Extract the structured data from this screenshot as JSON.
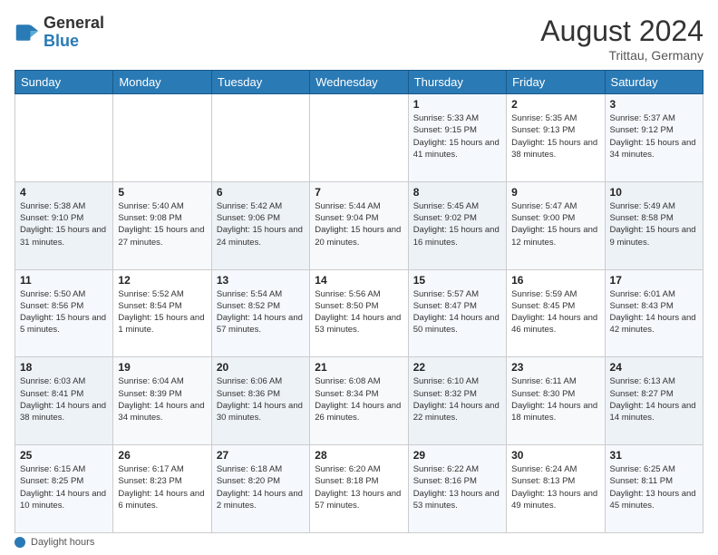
{
  "header": {
    "logo_line1": "General",
    "logo_line2": "Blue",
    "month_year": "August 2024",
    "location": "Trittau, Germany"
  },
  "weekdays": [
    "Sunday",
    "Monday",
    "Tuesday",
    "Wednesday",
    "Thursday",
    "Friday",
    "Saturday"
  ],
  "weeks": [
    [
      {
        "day": "",
        "info": ""
      },
      {
        "day": "",
        "info": ""
      },
      {
        "day": "",
        "info": ""
      },
      {
        "day": "",
        "info": ""
      },
      {
        "day": "1",
        "info": "Sunrise: 5:33 AM\nSunset: 9:15 PM\nDaylight: 15 hours\nand 41 minutes."
      },
      {
        "day": "2",
        "info": "Sunrise: 5:35 AM\nSunset: 9:13 PM\nDaylight: 15 hours\nand 38 minutes."
      },
      {
        "day": "3",
        "info": "Sunrise: 5:37 AM\nSunset: 9:12 PM\nDaylight: 15 hours\nand 34 minutes."
      }
    ],
    [
      {
        "day": "4",
        "info": "Sunrise: 5:38 AM\nSunset: 9:10 PM\nDaylight: 15 hours\nand 31 minutes."
      },
      {
        "day": "5",
        "info": "Sunrise: 5:40 AM\nSunset: 9:08 PM\nDaylight: 15 hours\nand 27 minutes."
      },
      {
        "day": "6",
        "info": "Sunrise: 5:42 AM\nSunset: 9:06 PM\nDaylight: 15 hours\nand 24 minutes."
      },
      {
        "day": "7",
        "info": "Sunrise: 5:44 AM\nSunset: 9:04 PM\nDaylight: 15 hours\nand 20 minutes."
      },
      {
        "day": "8",
        "info": "Sunrise: 5:45 AM\nSunset: 9:02 PM\nDaylight: 15 hours\nand 16 minutes."
      },
      {
        "day": "9",
        "info": "Sunrise: 5:47 AM\nSunset: 9:00 PM\nDaylight: 15 hours\nand 12 minutes."
      },
      {
        "day": "10",
        "info": "Sunrise: 5:49 AM\nSunset: 8:58 PM\nDaylight: 15 hours\nand 9 minutes."
      }
    ],
    [
      {
        "day": "11",
        "info": "Sunrise: 5:50 AM\nSunset: 8:56 PM\nDaylight: 15 hours\nand 5 minutes."
      },
      {
        "day": "12",
        "info": "Sunrise: 5:52 AM\nSunset: 8:54 PM\nDaylight: 15 hours\nand 1 minute."
      },
      {
        "day": "13",
        "info": "Sunrise: 5:54 AM\nSunset: 8:52 PM\nDaylight: 14 hours\nand 57 minutes."
      },
      {
        "day": "14",
        "info": "Sunrise: 5:56 AM\nSunset: 8:50 PM\nDaylight: 14 hours\nand 53 minutes."
      },
      {
        "day": "15",
        "info": "Sunrise: 5:57 AM\nSunset: 8:47 PM\nDaylight: 14 hours\nand 50 minutes."
      },
      {
        "day": "16",
        "info": "Sunrise: 5:59 AM\nSunset: 8:45 PM\nDaylight: 14 hours\nand 46 minutes."
      },
      {
        "day": "17",
        "info": "Sunrise: 6:01 AM\nSunset: 8:43 PM\nDaylight: 14 hours\nand 42 minutes."
      }
    ],
    [
      {
        "day": "18",
        "info": "Sunrise: 6:03 AM\nSunset: 8:41 PM\nDaylight: 14 hours\nand 38 minutes."
      },
      {
        "day": "19",
        "info": "Sunrise: 6:04 AM\nSunset: 8:39 PM\nDaylight: 14 hours\nand 34 minutes."
      },
      {
        "day": "20",
        "info": "Sunrise: 6:06 AM\nSunset: 8:36 PM\nDaylight: 14 hours\nand 30 minutes."
      },
      {
        "day": "21",
        "info": "Sunrise: 6:08 AM\nSunset: 8:34 PM\nDaylight: 14 hours\nand 26 minutes."
      },
      {
        "day": "22",
        "info": "Sunrise: 6:10 AM\nSunset: 8:32 PM\nDaylight: 14 hours\nand 22 minutes."
      },
      {
        "day": "23",
        "info": "Sunrise: 6:11 AM\nSunset: 8:30 PM\nDaylight: 14 hours\nand 18 minutes."
      },
      {
        "day": "24",
        "info": "Sunrise: 6:13 AM\nSunset: 8:27 PM\nDaylight: 14 hours\nand 14 minutes."
      }
    ],
    [
      {
        "day": "25",
        "info": "Sunrise: 6:15 AM\nSunset: 8:25 PM\nDaylight: 14 hours\nand 10 minutes."
      },
      {
        "day": "26",
        "info": "Sunrise: 6:17 AM\nSunset: 8:23 PM\nDaylight: 14 hours\nand 6 minutes."
      },
      {
        "day": "27",
        "info": "Sunrise: 6:18 AM\nSunset: 8:20 PM\nDaylight: 14 hours\nand 2 minutes."
      },
      {
        "day": "28",
        "info": "Sunrise: 6:20 AM\nSunset: 8:18 PM\nDaylight: 13 hours\nand 57 minutes."
      },
      {
        "day": "29",
        "info": "Sunrise: 6:22 AM\nSunset: 8:16 PM\nDaylight: 13 hours\nand 53 minutes."
      },
      {
        "day": "30",
        "info": "Sunrise: 6:24 AM\nSunset: 8:13 PM\nDaylight: 13 hours\nand 49 minutes."
      },
      {
        "day": "31",
        "info": "Sunrise: 6:25 AM\nSunset: 8:11 PM\nDaylight: 13 hours\nand 45 minutes."
      }
    ]
  ],
  "footer": {
    "daylight_label": "Daylight hours"
  }
}
